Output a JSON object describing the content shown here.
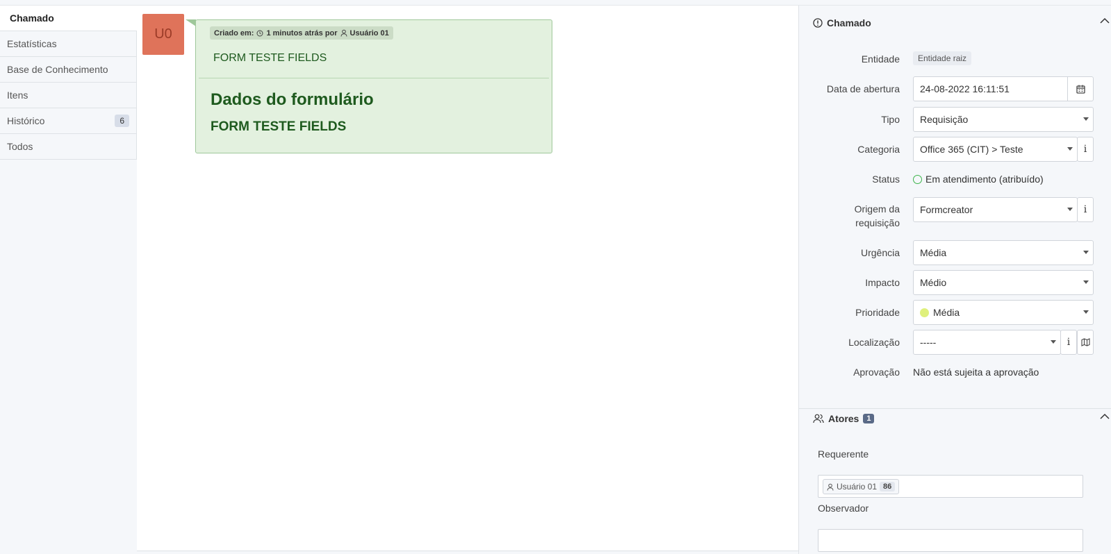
{
  "tabs": [
    {
      "label": "Chamado",
      "active": true
    },
    {
      "label": "Estatísticas"
    },
    {
      "label": "Base de Conhecimento"
    },
    {
      "label": "Itens"
    },
    {
      "label": "Histórico",
      "badge": "6"
    },
    {
      "label": "Todos"
    }
  ],
  "timeline": {
    "avatar": "U0",
    "meta_prefix": "Criado em:",
    "meta_time": "1 minutos atrás por",
    "meta_user": "Usuário 01",
    "content_title": "FORM TESTE FIELDS",
    "form_heading": "Dados do formulário",
    "form_subheading": "FORM TESTE FIELDS"
  },
  "panel": {
    "section_title": "Chamado",
    "entidade_label": "Entidade",
    "entidade_value": "Entidade raiz",
    "data_label": "Data de abertura",
    "data_value": "24-08-2022 16:11:51",
    "tipo_label": "Tipo",
    "tipo_value": "Requisição",
    "categoria_label": "Categoria",
    "categoria_value": "Office 365 (CIT) > Teste",
    "status_label": "Status",
    "status_value": "Em atendimento (atribuído)",
    "origem_label_1": "Origem da",
    "origem_label_2": "requisição",
    "origem_value": "Formcreator",
    "urgencia_label": "Urgência",
    "urgencia_value": "Média",
    "impacto_label": "Impacto",
    "impacto_value": "Médio",
    "prioridade_label": "Prioridade",
    "prioridade_value": "Média",
    "localizacao_label": "Localização",
    "localizacao_value": "-----",
    "aprovacao_label": "Aprovação",
    "aprovacao_value": "Não está sujeita a aprovação",
    "colors": {
      "status_ring": "#3bb34a",
      "priority_dot": "#dff07c"
    }
  },
  "actors": {
    "title": "Atores",
    "count": "1",
    "requerente_label": "Requerente",
    "requerente_user": "Usuário 01",
    "requerente_num": "86",
    "observador_label": "Observador"
  }
}
